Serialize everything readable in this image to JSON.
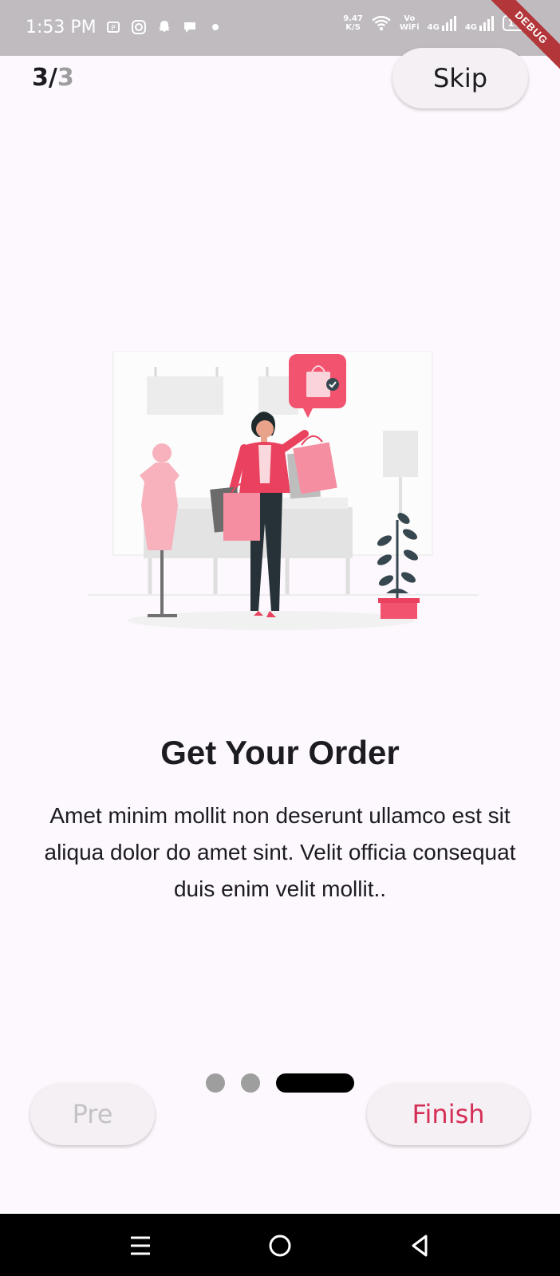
{
  "status_bar": {
    "time": "1:53 PM",
    "speed_value": "9.47",
    "speed_unit": "K/S",
    "network_label_1": "Vo",
    "network_label_2": "WiFi",
    "signal_1": "4G",
    "signal_2": "4G",
    "battery": "100",
    "debug_label": "DEBUG",
    "icons_left": [
      "payment-icon",
      "instagram-icon",
      "snapchat-icon",
      "chat-icon",
      "dot-icon"
    ]
  },
  "header": {
    "page_current": "3",
    "page_sep": "/",
    "page_total": "3",
    "skip_label": "Skip"
  },
  "content": {
    "title": "Get Your Order",
    "description": "Amet minim mollit non deserunt ullamco est sit aliqua dolor do amet sint. Velit officia consequat duis enim velit mollit.."
  },
  "pager": {
    "count": 3,
    "active_index": 2
  },
  "footer": {
    "pre_label": "Pre",
    "finish_label": "Finish"
  },
  "colors": {
    "accent": "#d62f57",
    "illustration_pink": "#f2546f",
    "background": "#fdf8fd"
  },
  "nav": [
    "menu-icon",
    "home-icon",
    "back-icon"
  ]
}
